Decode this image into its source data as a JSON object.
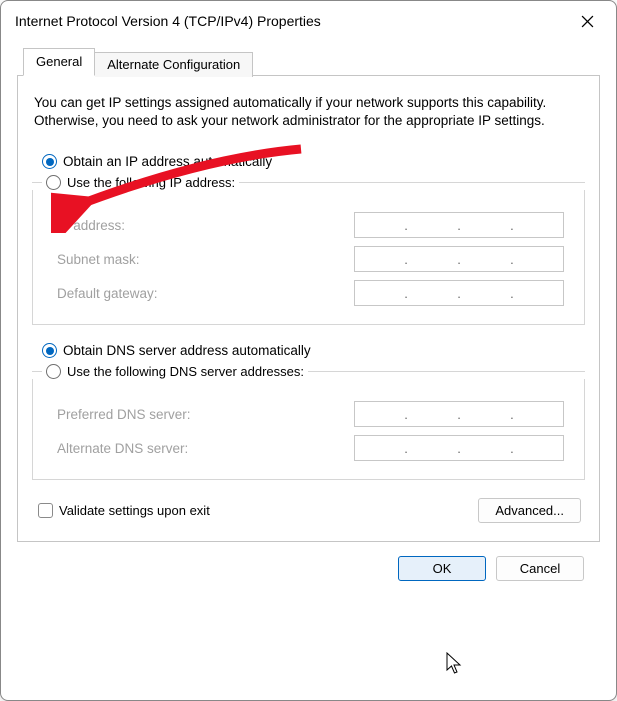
{
  "title": "Internet Protocol Version 4 (TCP/IPv4) Properties",
  "tabs": {
    "general": "General",
    "alt": "Alternate Configuration"
  },
  "desc": "You can get IP settings assigned automatically if your network supports this capability. Otherwise, you need to ask your network administrator for the appropriate IP settings.",
  "ip": {
    "obtain": "Obtain an IP address automatically",
    "use": "Use the following IP address:",
    "fields": {
      "addr": "IP address:",
      "mask": "Subnet mask:",
      "gw": "Default gateway:"
    }
  },
  "dns": {
    "obtain": "Obtain DNS server address automatically",
    "use": "Use the following DNS server addresses:",
    "fields": {
      "pref": "Preferred DNS server:",
      "alt": "Alternate DNS server:"
    }
  },
  "validate": "Validate settings upon exit",
  "buttons": {
    "advanced": "Advanced...",
    "ok": "OK",
    "cancel": "Cancel"
  }
}
